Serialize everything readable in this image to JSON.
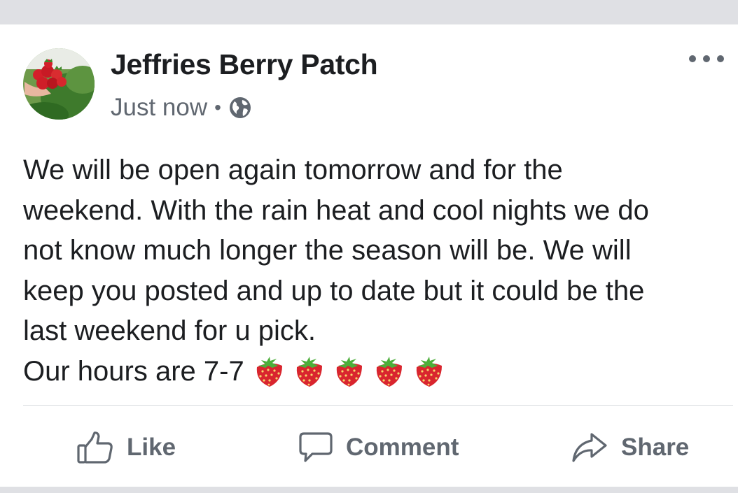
{
  "post": {
    "page_name": "Jeffries Berry Patch",
    "timestamp": "Just now",
    "separator": "•",
    "audience_icon": "globe-icon",
    "more_icon": "more-options-icon",
    "avatar_image": "strawberries-in-hands-photo",
    "text_lines": [
      "We will be open again tomorrow and for the",
      "weekend. With the rain heat and cool nights we do",
      "not know much longer the season will be. We will",
      "keep you posted and up to date but it could be the",
      "last weekend for u pick."
    ],
    "hours_line": "Our hours are 7-7",
    "emoji": [
      "🍓",
      "🍓",
      "🍓",
      "🍓",
      "🍓"
    ]
  },
  "actions": {
    "like": {
      "label": "Like",
      "icon": "thumbs-up-icon"
    },
    "comment": {
      "label": "Comment",
      "icon": "comment-bubble-icon"
    },
    "share": {
      "label": "Share",
      "icon": "share-arrow-icon"
    }
  },
  "colors": {
    "page_background": "#dfe0e4",
    "card": "#ffffff",
    "primary_text": "#1c1e21",
    "secondary_text": "#606770",
    "divider": "#dadde1",
    "strawberry_red": "#d9252e",
    "leaf_green": "#4caf3a"
  }
}
